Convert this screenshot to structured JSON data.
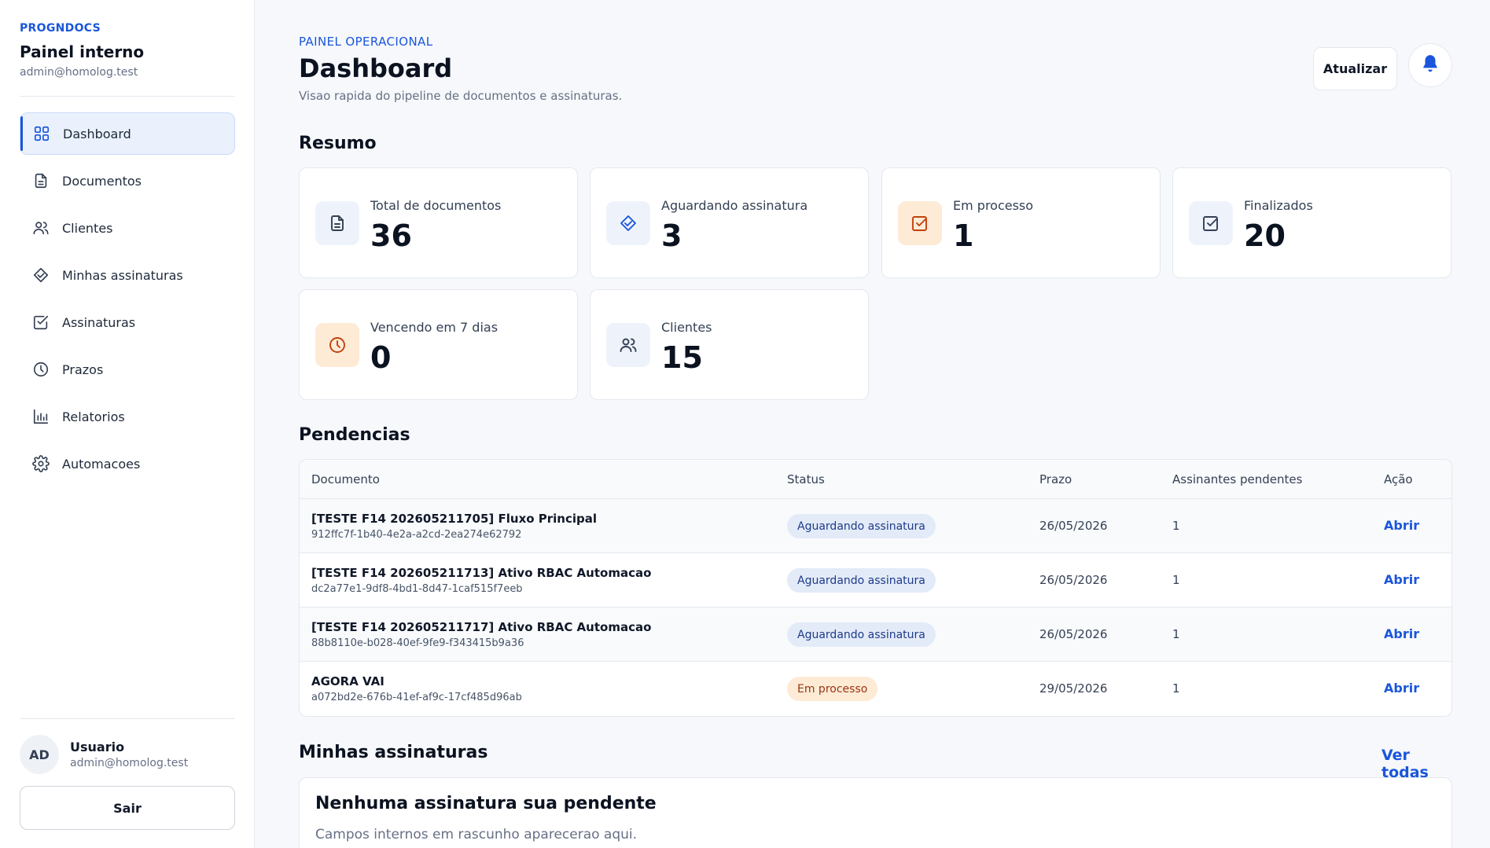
{
  "sidebar": {
    "brand_kicker": "PROGNDOCS",
    "brand_title": "Painel interno",
    "brand_email": "admin@homolog.test",
    "items": [
      {
        "label": "Dashboard",
        "icon": "dashboard-icon",
        "active": true
      },
      {
        "label": "Documentos",
        "icon": "document-icon"
      },
      {
        "label": "Clientes",
        "icon": "users-icon"
      },
      {
        "label": "Minhas assinaturas",
        "icon": "signature-icon"
      },
      {
        "label": "Assinaturas",
        "icon": "check-square-icon"
      },
      {
        "label": "Prazos",
        "icon": "clock-icon"
      },
      {
        "label": "Relatorios",
        "icon": "bar-chart-icon"
      },
      {
        "label": "Automacoes",
        "icon": "gear-icon"
      }
    ],
    "user": {
      "initials": "AD",
      "name": "Usuario",
      "email": "admin@homolog.test"
    },
    "logout_label": "Sair"
  },
  "header": {
    "kicker": "PAINEL OPERACIONAL",
    "title": "Dashboard",
    "subtitle": "Visao rapida do pipeline de documentos e assinaturas.",
    "refresh_label": "Atualizar"
  },
  "summary": {
    "title": "Resumo",
    "cards": [
      {
        "label": "Total de documentos",
        "value": "36",
        "icon": "document-icon"
      },
      {
        "label": "Aguardando assinatura",
        "value": "3",
        "icon": "signature-icon"
      },
      {
        "label": "Em processo",
        "value": "1",
        "icon": "check-square-icon"
      },
      {
        "label": "Finalizados",
        "value": "20",
        "icon": "check-square-icon"
      },
      {
        "label": "Vencendo em 7 dias",
        "value": "0",
        "icon": "clock-icon"
      },
      {
        "label": "Clientes",
        "value": "15",
        "icon": "users-icon"
      }
    ]
  },
  "pending": {
    "title": "Pendencias",
    "columns": [
      "Documento",
      "Status",
      "Prazo",
      "Assinantes pendentes",
      "Ação"
    ],
    "rows": [
      {
        "title": "[TESTE F14 202605211705] Fluxo Principal",
        "id": "912ffc7f-1b40-4e2a-a2cd-2ea274e62792",
        "status": "Aguardando assinatura",
        "status_kind": "blue",
        "deadline": "26/05/2026",
        "pending": "1",
        "action": "Abrir"
      },
      {
        "title": "[TESTE F14 202605211713] Ativo RBAC Automacao",
        "id": "dc2a77e1-9df8-4bd1-8d47-1caf515f7eeb",
        "status": "Aguardando assinatura",
        "status_kind": "blue",
        "deadline": "26/05/2026",
        "pending": "1",
        "action": "Abrir"
      },
      {
        "title": "[TESTE F14 202605211717] Ativo RBAC Automacao",
        "id": "88b8110e-b028-40ef-9fe9-f343415b9a36",
        "status": "Aguardando assinatura",
        "status_kind": "blue",
        "deadline": "26/05/2026",
        "pending": "1",
        "action": "Abrir"
      },
      {
        "title": "AGORA VAI",
        "id": "a072bd2e-676b-41ef-af9c-17cf485d96ab",
        "status": "Em processo",
        "status_kind": "orange",
        "deadline": "29/05/2026",
        "pending": "1",
        "action": "Abrir"
      }
    ]
  },
  "my_signatures": {
    "title": "Minhas assinaturas",
    "see_all": "Ver todas",
    "empty_title": "Nenhuma assinatura sua pendente",
    "empty_subtitle": "Campos internos em rascunho aparecerao aqui."
  },
  "colors": {
    "accent": "#1a56db",
    "orange": "#c2410c",
    "orange_bg": "#fdebd6",
    "blue_bg": "#eef3fb"
  }
}
